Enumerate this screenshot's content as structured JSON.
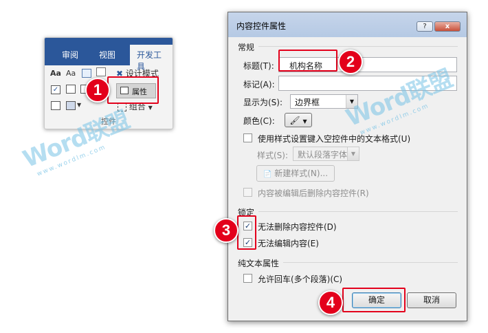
{
  "ribbon": {
    "tabs": [
      "审阅",
      "视图",
      "开发工具"
    ],
    "design_mode": "设计模式",
    "properties": "属性",
    "group": "组合",
    "group_label": "控件",
    "font_a1": "Aa",
    "font_a2": "Aa"
  },
  "dialog": {
    "title": "内容控件属性",
    "help_btn": "?",
    "close_btn": "x",
    "general": {
      "heading": "常规",
      "title_label": "标题(T):",
      "title_value": "机构名称",
      "tag_label": "标记(A):",
      "tag_value": "",
      "show_as_label": "显示为(S):",
      "show_as_value": "边界框",
      "color_label": "颜色(C):",
      "use_style_label": "使用样式设置键入空控件中的文本格式(U)",
      "style_label": "样式(S):",
      "style_value": "默认段落字体",
      "new_style_btn": "新建样式(N)...",
      "remove_label": "内容被编辑后删除内容控件(R)"
    },
    "locking": {
      "heading": "锁定",
      "no_delete_label": "无法删除内容控件(D)",
      "no_delete_checked": true,
      "no_edit_label": "无法编辑内容(E)",
      "no_edit_checked": true
    },
    "plain_text": {
      "heading": "纯文本属性",
      "allow_cr_label": "允许回车(多个段落)(C)"
    },
    "ok_btn": "确定",
    "cancel_btn": "取消"
  },
  "callouts": [
    "1",
    "2",
    "3",
    "4"
  ],
  "watermark": {
    "text": "Word联盟",
    "url": "www.wordlm.com"
  },
  "colors": {
    "accent_red": "#e3001b",
    "ribbon_blue": "#2b579a",
    "watermark": "#78c3e6"
  }
}
